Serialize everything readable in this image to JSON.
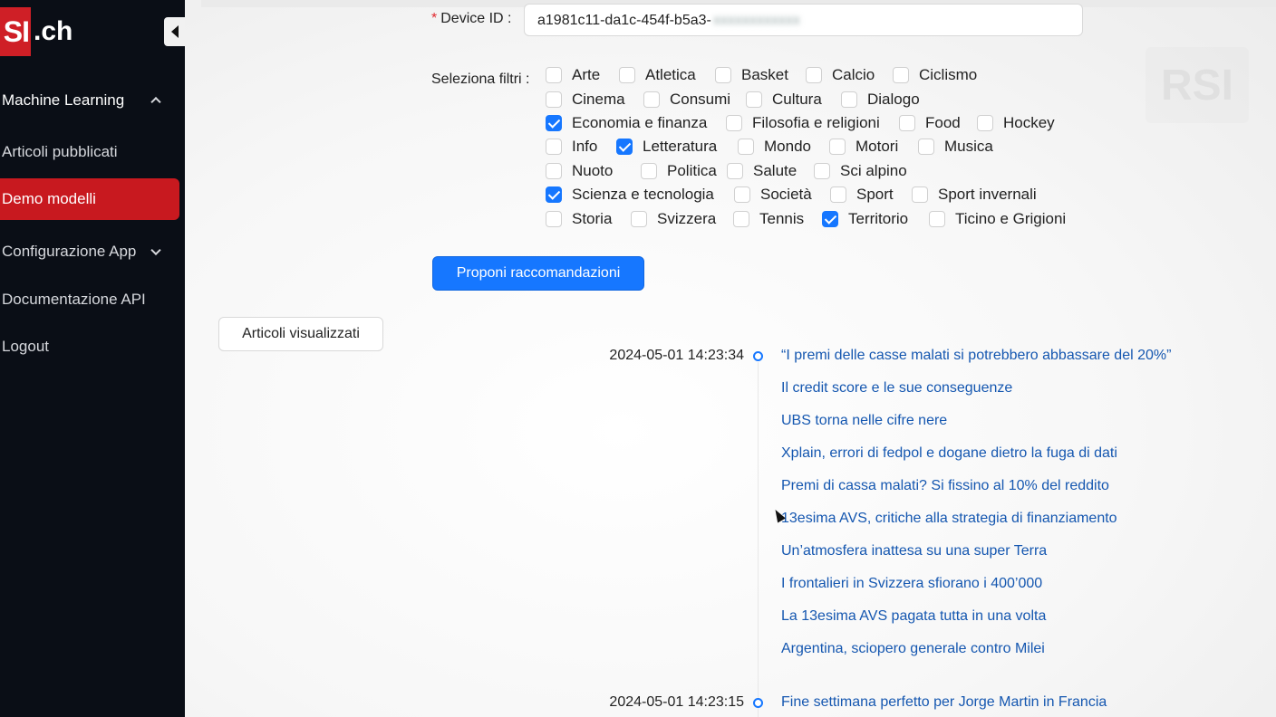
{
  "brand": {
    "logo_box": "SI",
    "logo_text": ".ch",
    "color": "#cf1f26"
  },
  "sidebar": {
    "items": [
      {
        "label": "Machine Learning",
        "type": "group",
        "expanded": true
      },
      {
        "label": "Articoli pubblicati"
      },
      {
        "label": "Demo modelli",
        "active": true
      },
      {
        "label": "Configurazione App",
        "type": "group",
        "expanded": false
      },
      {
        "label": "Documentazione API"
      },
      {
        "label": "Logout"
      }
    ]
  },
  "form": {
    "device_label": "Device ID",
    "device_required_mark": "*",
    "device_value": "a1981c11-da1c-454f-b5a3-",
    "device_value_hidden": "xxxxxxxxxxxx",
    "filters_label": "Seleziona filtri",
    "filters": [
      {
        "label": "Arte",
        "checked": false
      },
      {
        "label": "Atletica",
        "checked": false
      },
      {
        "label": "Basket",
        "checked": false
      },
      {
        "label": "Calcio",
        "checked": false
      },
      {
        "label": "Ciclismo",
        "checked": false
      },
      {
        "label": "Cinema",
        "checked": false
      },
      {
        "label": "Consumi",
        "checked": false
      },
      {
        "label": "Cultura",
        "checked": false
      },
      {
        "label": "Dialogo",
        "checked": false
      },
      {
        "label": "Economia e finanza",
        "checked": true
      },
      {
        "label": "Filosofia e religioni",
        "checked": false
      },
      {
        "label": "Food",
        "checked": false
      },
      {
        "label": "Hockey",
        "checked": false
      },
      {
        "label": "Info",
        "checked": false
      },
      {
        "label": "Letteratura",
        "checked": true
      },
      {
        "label": "Mondo",
        "checked": false
      },
      {
        "label": "Motori",
        "checked": false
      },
      {
        "label": "Musica",
        "checked": false
      },
      {
        "label": "Nuoto",
        "checked": false
      },
      {
        "label": "Politica",
        "checked": false
      },
      {
        "label": "Salute",
        "checked": false
      },
      {
        "label": "Sci alpino",
        "checked": false
      },
      {
        "label": "Scienza e tecnologia",
        "checked": true
      },
      {
        "label": "Società",
        "checked": false
      },
      {
        "label": "Sport",
        "checked": false
      },
      {
        "label": "Sport invernali",
        "checked": false
      },
      {
        "label": "Storia",
        "checked": false
      },
      {
        "label": "Svizzera",
        "checked": false
      },
      {
        "label": "Tennis",
        "checked": false
      },
      {
        "label": "Territorio",
        "checked": true
      },
      {
        "label": "Ticino e Grigioni",
        "checked": false
      }
    ],
    "submit_label": "Proponi raccomandazioni"
  },
  "viewed_button": "Articoli visualizzati",
  "timeline": [
    {
      "time": "2024-05-01 14:23:34",
      "articles": [
        "“I premi delle casse malati si potrebbero abbassare del 20%”",
        "Il credit score e le sue conseguenze",
        "UBS torna nelle cifre nere",
        "Xplain, errori di fedpol e dogane dietro la fuga di dati",
        "Premi di cassa malati? Si fissino al 10% del reddito",
        "13esima AVS, critiche alla strategia di finanziamento",
        "Un’atmosfera inattesa su una super Terra",
        "I frontalieri in Svizzera sfiorano i 400’000",
        "La 13esima AVS pagata tutta in una volta",
        "Argentina, sciopero generale contro Milei"
      ]
    },
    {
      "time": "2024-05-01 14:23:15",
      "articles": [
        "Fine settimana perfetto per Jorge Martin in Francia"
      ]
    }
  ],
  "watermark": "RSI",
  "colors": {
    "primary": "#1677ff",
    "link": "#1557b0",
    "sidebar_bg": "#0a0e16",
    "active": "#c8191f"
  }
}
